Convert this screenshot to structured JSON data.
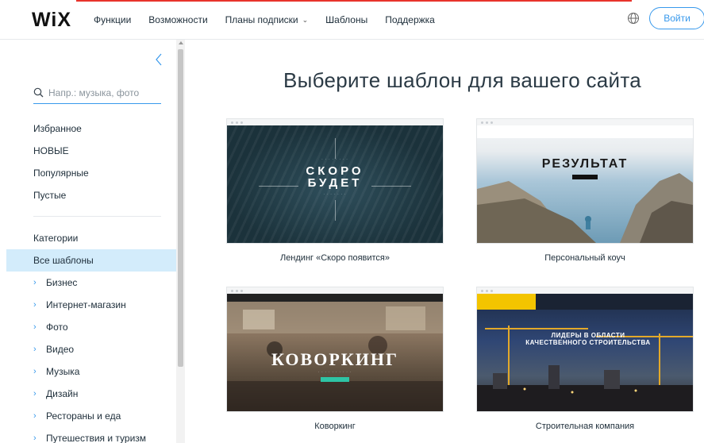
{
  "header": {
    "logo": "WiX",
    "nav": [
      {
        "label": "Функции",
        "has_dropdown": false
      },
      {
        "label": "Возможности",
        "has_dropdown": false
      },
      {
        "label": "Планы подписки",
        "has_dropdown": true
      },
      {
        "label": "Шаблоны",
        "has_dropdown": false
      },
      {
        "label": "Поддержка",
        "has_dropdown": false
      }
    ],
    "login_label": "Войти"
  },
  "sidebar": {
    "search_placeholder": "Напр.: музыка, фото",
    "filters": [
      "Избранное",
      "НОВЫЕ",
      "Популярные",
      "Пустые"
    ],
    "categories_heading": "Категории",
    "all_templates": "Все шаблоны",
    "categories": [
      "Бизнес",
      "Интернет-магазин",
      "Фото",
      "Видео",
      "Музыка",
      "Дизайн",
      "Рестораны и еда",
      "Путешествия и туризм"
    ]
  },
  "main": {
    "title": "Выберите шаблон для вашего сайта",
    "templates": [
      {
        "caption": "Лендинг «Скоро появится»",
        "headline_1": "СКОРО",
        "headline_2": "БУДЕТ"
      },
      {
        "caption": "Персональный коуч",
        "headline": "РЕЗУЛЬТАТ"
      },
      {
        "caption": "Коворкинг",
        "headline": "КОВОРКИНГ"
      },
      {
        "caption": "Строительная компания",
        "headline": "ЛИДЕРЫ В ОБЛАСТИ КАЧЕСТВЕННОГО СТРОИТЕЛЬСТВА"
      }
    ]
  },
  "colors": {
    "accent": "#3899ec",
    "selected_bg": "#d3ecfb",
    "top_accent": "#e8332b"
  }
}
